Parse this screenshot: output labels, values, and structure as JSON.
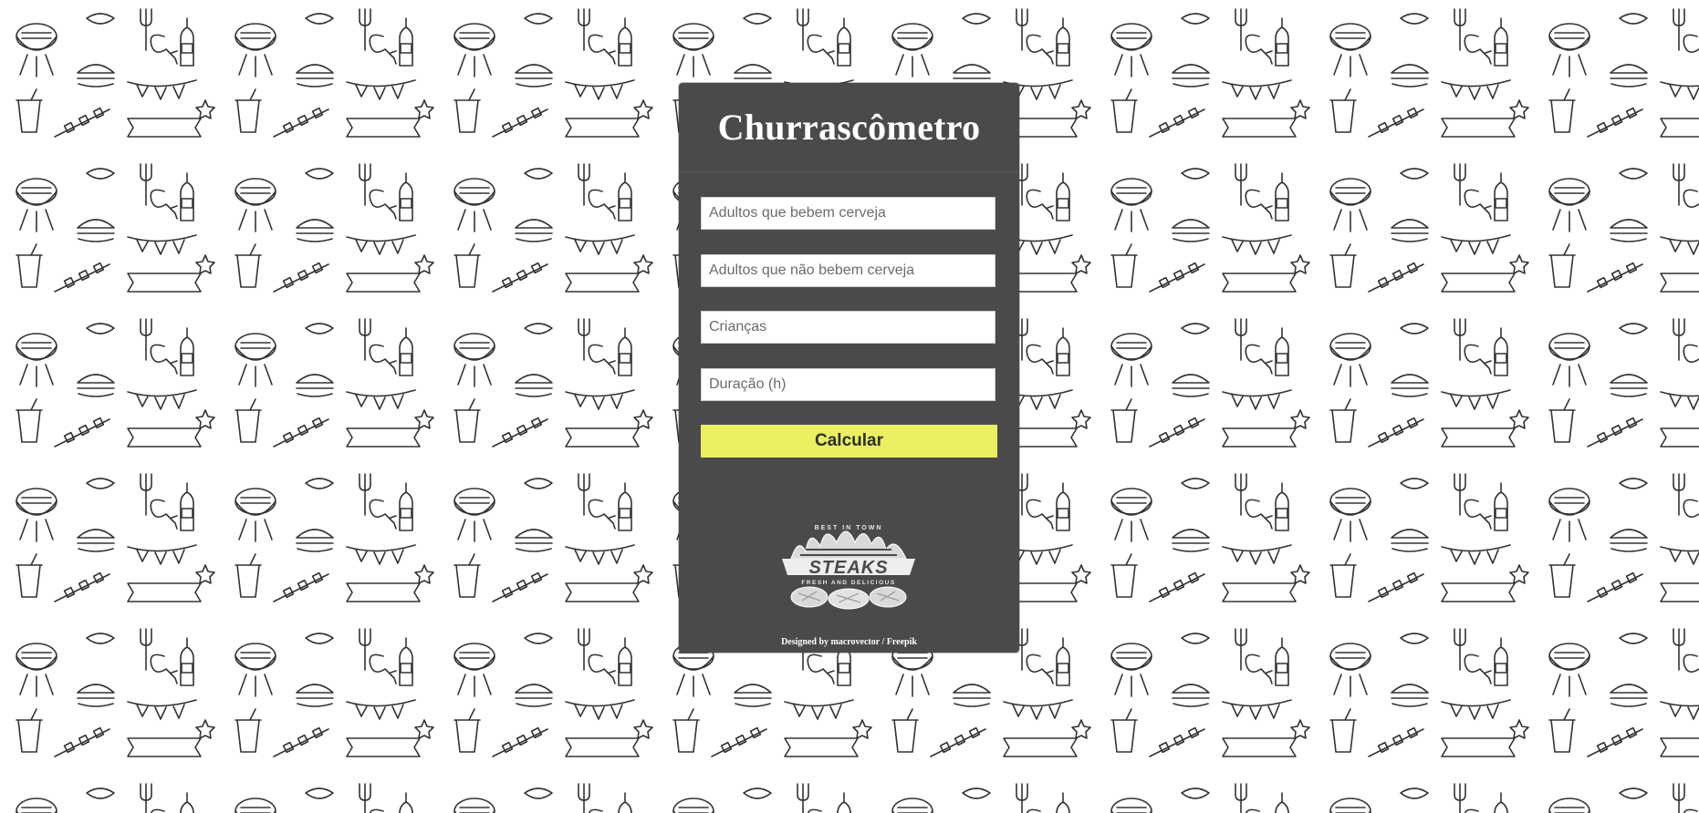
{
  "page": {
    "title": "Churrascômetro"
  },
  "form": {
    "fields": [
      {
        "placeholder": "Adultos que bebem cerveja"
      },
      {
        "placeholder": "Adultos que não bebem cerveja"
      },
      {
        "placeholder": "Crianças"
      },
      {
        "placeholder": "Duração (h)"
      }
    ],
    "submit_label": "Calcular"
  },
  "logo": {
    "icon": "steaks-logo-icon",
    "top_text": "BEST IN TOWN",
    "main_text": "STEAKS",
    "sub_text": "FRESH AND DELICIOUS"
  },
  "footer": {
    "credit": "Designed by macrovector / Freepik"
  },
  "background": {
    "icon": "bbq-doodle-pattern"
  },
  "colors": {
    "card": "#4a4a4c",
    "button": "#eaf061",
    "background": "#ffffff"
  }
}
